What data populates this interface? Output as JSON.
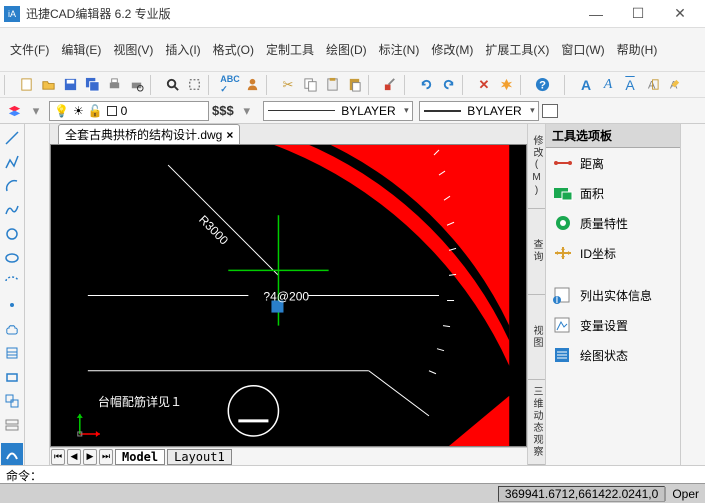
{
  "title": "迅捷CAD编辑器 6.2 专业版",
  "menu": [
    "文件(F)",
    "编辑(E)",
    "视图(V)",
    "插入(I)",
    "格式(O)",
    "定制工具",
    "绘图(D)",
    "标注(N)",
    "修改(M)",
    "扩展工具(X)",
    "窗口(W)",
    "帮助(H)"
  ],
  "layer": {
    "lightbulb": "💡",
    "name": "0"
  },
  "money": "$$$",
  "bylayer": "BYLAYER",
  "doc_tab": "全套古典拱桥的结构设计.dwg",
  "model_tabs": [
    "Model",
    "Layout1"
  ],
  "palette_title": "工具选项板",
  "palette_items": [
    {
      "icon": "distance",
      "label": "距离",
      "color": "#d04030"
    },
    {
      "icon": "area",
      "label": "面积",
      "color": "#1aa850"
    },
    {
      "icon": "massprop",
      "label": "质量特性",
      "color": "#1aa850"
    },
    {
      "icon": "id",
      "label": "ID坐标",
      "color": "#d9a030"
    },
    {
      "icon": "list",
      "label": "列出实体信息",
      "color": "#2a7fca"
    },
    {
      "icon": "var",
      "label": "变量设置",
      "color": "#2a7fca"
    },
    {
      "icon": "status",
      "label": "绘图状态",
      "color": "#2a7fca"
    }
  ],
  "side_tabs": [
    "修改(M)",
    "查询",
    "视图",
    "三维动态观察"
  ],
  "cmd_prompt": "命令：",
  "status_coords": "369941.6712,661422.0241,0",
  "status_right": "Oper",
  "canvas_text": {
    "r3000": "R3000",
    "spacing": "?4@200",
    "caption": "台帽配筋详见１"
  },
  "text_style": {
    "a1": "A",
    "a2": "A",
    "a3": "A"
  }
}
